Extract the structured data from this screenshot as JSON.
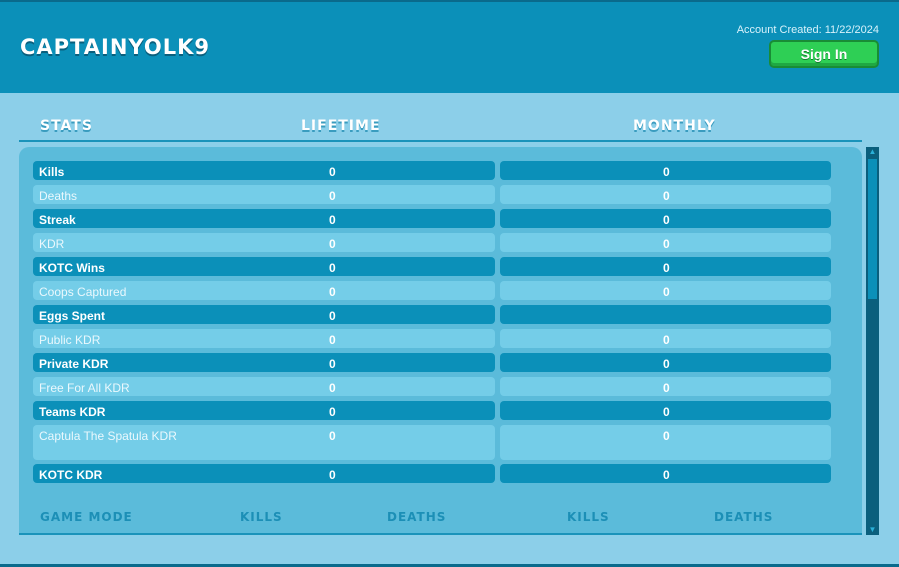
{
  "header": {
    "username": "CAPTAINYOLK9",
    "account_created": "Account Created: 11/22/2024",
    "signin_label": "Sign In"
  },
  "columns": {
    "stats": "STATS",
    "lifetime": "LIFETIME",
    "monthly": "MONTHLY"
  },
  "stats": [
    {
      "label": "Kills",
      "lifetime": "0",
      "monthly": "0"
    },
    {
      "label": "Deaths",
      "lifetime": "0",
      "monthly": "0"
    },
    {
      "label": "Streak",
      "lifetime": "0",
      "monthly": "0"
    },
    {
      "label": "KDR",
      "lifetime": "0",
      "monthly": "0"
    },
    {
      "label": "KOTC Wins",
      "lifetime": "0",
      "monthly": "0"
    },
    {
      "label": "Coops Captured",
      "lifetime": "0",
      "monthly": "0"
    },
    {
      "label": "Eggs Spent",
      "lifetime": "0",
      "monthly": ""
    },
    {
      "label": "Public KDR",
      "lifetime": "0",
      "monthly": "0"
    },
    {
      "label": "Private KDR",
      "lifetime": "0",
      "monthly": "0"
    },
    {
      "label": "Free For All KDR",
      "lifetime": "0",
      "monthly": "0"
    },
    {
      "label": "Teams KDR",
      "lifetime": "0",
      "monthly": "0"
    },
    {
      "label": "Captula The Spatula KDR",
      "lifetime": "0",
      "monthly": "0"
    },
    {
      "label": "KOTC KDR",
      "lifetime": "0",
      "monthly": "0"
    }
  ],
  "game_mode_headers": {
    "game_mode": "GAME MODE",
    "kills_lifetime": "KILLS",
    "deaths_lifetime": "DEATHS",
    "kills_monthly": "KILLS",
    "deaths_monthly": "DEATHS"
  },
  "colors": {
    "header_bg": "#0b90b9",
    "page_bg": "#8ccfe9",
    "panel_bg": "#5bbbda",
    "row_dark": "#0b90b9",
    "row_light": "#74cde8",
    "signin_green": "#2ecf55"
  }
}
